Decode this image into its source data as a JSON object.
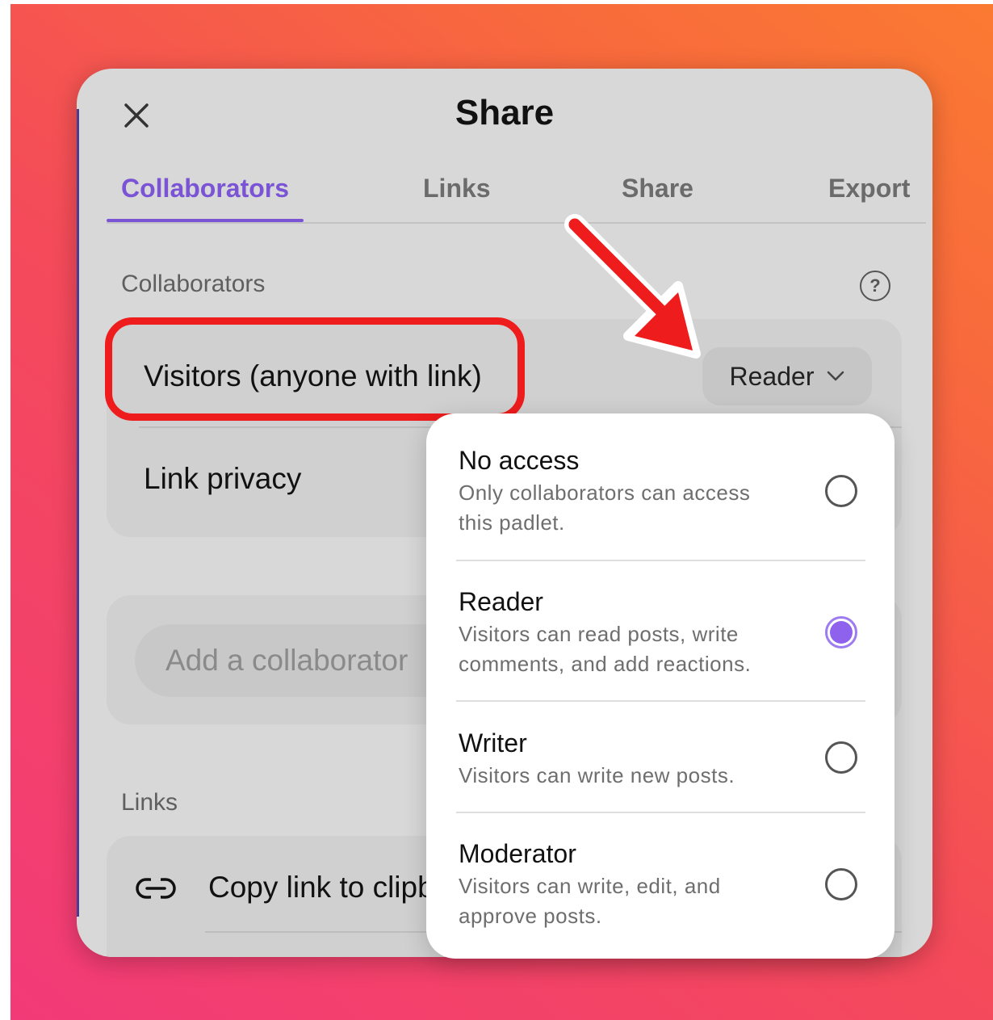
{
  "dialog": {
    "title": "Share",
    "close_icon": "close-icon"
  },
  "tabs": [
    {
      "label": "Collaborators",
      "active": true
    },
    {
      "label": "Links",
      "active": false
    },
    {
      "label": "Share",
      "active": false
    },
    {
      "label": "Export",
      "active": false
    }
  ],
  "collaborators": {
    "section_label": "Collaborators",
    "help_icon": "question-circle-icon",
    "help_glyph": "?",
    "visitors_label": "Visitors (anyone with link)",
    "role_value": "Reader",
    "role_chevron_icon": "chevron-down-icon",
    "link_privacy_label": "Link privacy",
    "add_placeholder": "Add a collaborator"
  },
  "links": {
    "section_label": "Links",
    "copy_link_label": "Copy link to clipboard",
    "link_icon": "link-icon"
  },
  "dropdown": {
    "options": [
      {
        "title": "No access",
        "description": "Only collaborators can access this padlet.",
        "selected": false
      },
      {
        "title": "Reader",
        "description": "Visitors can read posts, write comments, and add reactions.",
        "selected": true
      },
      {
        "title": "Writer",
        "description": "Visitors can write new posts.",
        "selected": false
      },
      {
        "title": "Moderator",
        "description": "Visitors can write, edit, and approve posts.",
        "selected": false
      }
    ]
  },
  "colors": {
    "accent": "#7b54d6",
    "radio_selected": "#8f62ee",
    "annotation_red": "#ee1c1c"
  }
}
